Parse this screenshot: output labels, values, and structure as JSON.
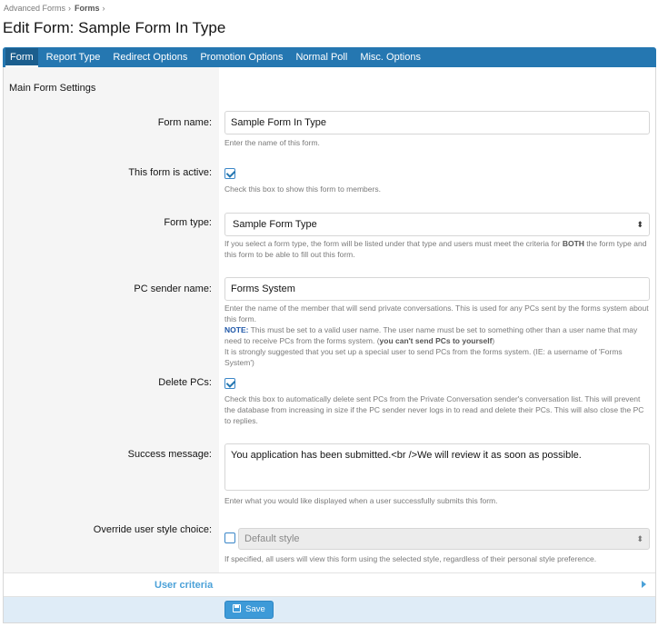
{
  "breadcrumb": {
    "items": [
      "Advanced Forms",
      "Forms"
    ],
    "separator": "›"
  },
  "page_title": "Edit Form: Sample Form In Type",
  "tabs": [
    {
      "label": "Form",
      "active": true
    },
    {
      "label": "Report Type",
      "active": false
    },
    {
      "label": "Redirect Options",
      "active": false
    },
    {
      "label": "Promotion Options",
      "active": false
    },
    {
      "label": "Normal Poll",
      "active": false
    },
    {
      "label": "Misc. Options",
      "active": false
    }
  ],
  "section_title": "Main Form Settings",
  "fields": {
    "form_name": {
      "label": "Form name:",
      "value": "Sample Form In Type",
      "hint": "Enter the name of this form."
    },
    "active": {
      "label": "This form is active:",
      "checked": true,
      "hint": "Check this box to show this form to members."
    },
    "form_type": {
      "label": "Form type:",
      "value": "Sample Form Type",
      "hint_pre": "If you select a form type, the form will be listed under that type and users must meet the criteria for ",
      "hint_bold": "BOTH",
      "hint_post": " the form type and this form to be able to fill out this form."
    },
    "pc_sender": {
      "label": "PC sender name:",
      "value": "Forms System",
      "hint_1": "Enter the name of the member that will send private conversations. This is used for any PCs sent by the forms system about this form.",
      "note_label": "NOTE:",
      "note_text": " This must be set to a valid user name. The user name must be set to something other than a user name that may need to receive PCs from the forms system. (",
      "note_bold": "you can't send PCs to yourself",
      "note_end": ")",
      "hint_3": "It is strongly suggested that you set up a special user to send PCs from the forms system. (IE: a username of 'Forms System')"
    },
    "delete_pcs": {
      "label": "Delete PCs:",
      "checked": true,
      "hint": "Check this box to automatically delete sent PCs from the Private Conversation sender's conversation list. This will prevent the database from increasing in size if the PC sender never logs in to read and delete their PCs. This will also close the PC to replies."
    },
    "success_message": {
      "label": "Success message:",
      "value": "You application has been submitted.<br />We will review it as soon as possible.",
      "hint": "Enter what you would like displayed when a user successfully submits this form."
    },
    "override_style": {
      "label": "Override user style choice:",
      "checked": false,
      "select_value": "Default style",
      "hint": "If specified, all users will view this form using the selected style, regardless of their personal style preference."
    }
  },
  "user_criteria": {
    "label": "User criteria"
  },
  "save_button": {
    "label": "Save"
  },
  "colors": {
    "tab_bar": "#2577b1",
    "accent": "#4ba1d8",
    "save_button": "#3d9ad8",
    "footer": "#dfecf7",
    "label_column": "#f5f5f5"
  }
}
